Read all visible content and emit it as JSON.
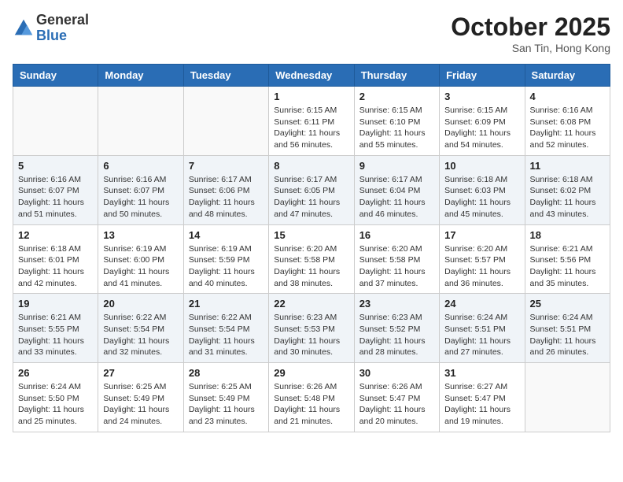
{
  "header": {
    "logo_general": "General",
    "logo_blue": "Blue",
    "month_title": "October 2025",
    "subtitle": "San Tin, Hong Kong"
  },
  "days_of_week": [
    "Sunday",
    "Monday",
    "Tuesday",
    "Wednesday",
    "Thursday",
    "Friday",
    "Saturday"
  ],
  "weeks": [
    [
      {
        "day": "",
        "info": ""
      },
      {
        "day": "",
        "info": ""
      },
      {
        "day": "",
        "info": ""
      },
      {
        "day": "1",
        "info": "Sunrise: 6:15 AM\nSunset: 6:11 PM\nDaylight: 11 hours\nand 56 minutes."
      },
      {
        "day": "2",
        "info": "Sunrise: 6:15 AM\nSunset: 6:10 PM\nDaylight: 11 hours\nand 55 minutes."
      },
      {
        "day": "3",
        "info": "Sunrise: 6:15 AM\nSunset: 6:09 PM\nDaylight: 11 hours\nand 54 minutes."
      },
      {
        "day": "4",
        "info": "Sunrise: 6:16 AM\nSunset: 6:08 PM\nDaylight: 11 hours\nand 52 minutes."
      }
    ],
    [
      {
        "day": "5",
        "info": "Sunrise: 6:16 AM\nSunset: 6:07 PM\nDaylight: 11 hours\nand 51 minutes."
      },
      {
        "day": "6",
        "info": "Sunrise: 6:16 AM\nSunset: 6:07 PM\nDaylight: 11 hours\nand 50 minutes."
      },
      {
        "day": "7",
        "info": "Sunrise: 6:17 AM\nSunset: 6:06 PM\nDaylight: 11 hours\nand 48 minutes."
      },
      {
        "day": "8",
        "info": "Sunrise: 6:17 AM\nSunset: 6:05 PM\nDaylight: 11 hours\nand 47 minutes."
      },
      {
        "day": "9",
        "info": "Sunrise: 6:17 AM\nSunset: 6:04 PM\nDaylight: 11 hours\nand 46 minutes."
      },
      {
        "day": "10",
        "info": "Sunrise: 6:18 AM\nSunset: 6:03 PM\nDaylight: 11 hours\nand 45 minutes."
      },
      {
        "day": "11",
        "info": "Sunrise: 6:18 AM\nSunset: 6:02 PM\nDaylight: 11 hours\nand 43 minutes."
      }
    ],
    [
      {
        "day": "12",
        "info": "Sunrise: 6:18 AM\nSunset: 6:01 PM\nDaylight: 11 hours\nand 42 minutes."
      },
      {
        "day": "13",
        "info": "Sunrise: 6:19 AM\nSunset: 6:00 PM\nDaylight: 11 hours\nand 41 minutes."
      },
      {
        "day": "14",
        "info": "Sunrise: 6:19 AM\nSunset: 5:59 PM\nDaylight: 11 hours\nand 40 minutes."
      },
      {
        "day": "15",
        "info": "Sunrise: 6:20 AM\nSunset: 5:58 PM\nDaylight: 11 hours\nand 38 minutes."
      },
      {
        "day": "16",
        "info": "Sunrise: 6:20 AM\nSunset: 5:58 PM\nDaylight: 11 hours\nand 37 minutes."
      },
      {
        "day": "17",
        "info": "Sunrise: 6:20 AM\nSunset: 5:57 PM\nDaylight: 11 hours\nand 36 minutes."
      },
      {
        "day": "18",
        "info": "Sunrise: 6:21 AM\nSunset: 5:56 PM\nDaylight: 11 hours\nand 35 minutes."
      }
    ],
    [
      {
        "day": "19",
        "info": "Sunrise: 6:21 AM\nSunset: 5:55 PM\nDaylight: 11 hours\nand 33 minutes."
      },
      {
        "day": "20",
        "info": "Sunrise: 6:22 AM\nSunset: 5:54 PM\nDaylight: 11 hours\nand 32 minutes."
      },
      {
        "day": "21",
        "info": "Sunrise: 6:22 AM\nSunset: 5:54 PM\nDaylight: 11 hours\nand 31 minutes."
      },
      {
        "day": "22",
        "info": "Sunrise: 6:23 AM\nSunset: 5:53 PM\nDaylight: 11 hours\nand 30 minutes."
      },
      {
        "day": "23",
        "info": "Sunrise: 6:23 AM\nSunset: 5:52 PM\nDaylight: 11 hours\nand 28 minutes."
      },
      {
        "day": "24",
        "info": "Sunrise: 6:24 AM\nSunset: 5:51 PM\nDaylight: 11 hours\nand 27 minutes."
      },
      {
        "day": "25",
        "info": "Sunrise: 6:24 AM\nSunset: 5:51 PM\nDaylight: 11 hours\nand 26 minutes."
      }
    ],
    [
      {
        "day": "26",
        "info": "Sunrise: 6:24 AM\nSunset: 5:50 PM\nDaylight: 11 hours\nand 25 minutes."
      },
      {
        "day": "27",
        "info": "Sunrise: 6:25 AM\nSunset: 5:49 PM\nDaylight: 11 hours\nand 24 minutes."
      },
      {
        "day": "28",
        "info": "Sunrise: 6:25 AM\nSunset: 5:49 PM\nDaylight: 11 hours\nand 23 minutes."
      },
      {
        "day": "29",
        "info": "Sunrise: 6:26 AM\nSunset: 5:48 PM\nDaylight: 11 hours\nand 21 minutes."
      },
      {
        "day": "30",
        "info": "Sunrise: 6:26 AM\nSunset: 5:47 PM\nDaylight: 11 hours\nand 20 minutes."
      },
      {
        "day": "31",
        "info": "Sunrise: 6:27 AM\nSunset: 5:47 PM\nDaylight: 11 hours\nand 19 minutes."
      },
      {
        "day": "",
        "info": ""
      }
    ]
  ]
}
